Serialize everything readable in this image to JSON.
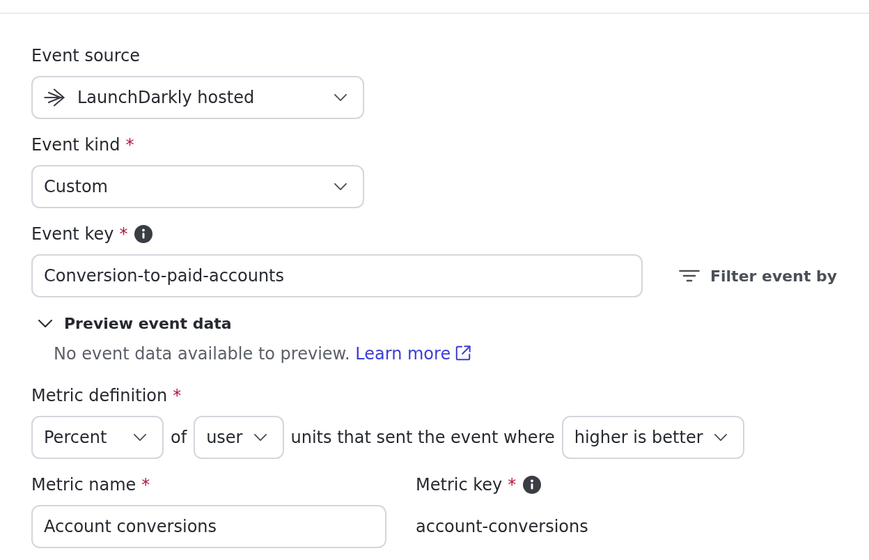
{
  "fields": [
    {
      "kind": "select",
      "label": "Event source",
      "info": false,
      "leading_icon": true,
      "value": "LaunchDarkly hosted"
    },
    {
      "kind": "select",
      "label": "Event kind",
      "required_mark": "*",
      "info": false,
      "leading_icon": false,
      "value": "Custom"
    },
    {
      "kind": "input",
      "label": "Event key",
      "required_mark": "*",
      "info": true,
      "value": "Conversion-to-paid-accounts",
      "action": "Filter event by"
    }
  ],
  "preview": {
    "title": "Preview event data",
    "expanded": true,
    "message": "No event data available to preview.",
    "link": "Learn more"
  },
  "metric_definition": {
    "label": "Metric definition",
    "required_mark": "*",
    "info": false,
    "parts": [
      {
        "kind": "select",
        "value": "Percent"
      },
      {
        "kind": "text",
        "text": "of"
      },
      {
        "kind": "select",
        "value": "user"
      },
      {
        "kind": "text",
        "text": "units that sent the event where"
      },
      {
        "kind": "select",
        "value": "higher is better"
      }
    ]
  },
  "metric_fields": [
    {
      "kind": "input",
      "label": "Metric name",
      "required_mark": "*",
      "info": false,
      "value": "Account conversions"
    },
    {
      "kind": "readonly",
      "label": "Metric key",
      "required_mark": "*",
      "info": true,
      "value": "account-conversions"
    }
  ]
}
